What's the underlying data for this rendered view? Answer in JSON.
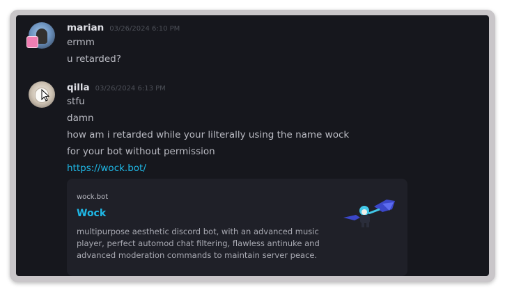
{
  "messages": [
    {
      "username": "marian",
      "timestamp": "03/26/2024 6:10 PM",
      "lines": [
        "ermm",
        "u retarded?"
      ]
    },
    {
      "username": "qilla",
      "timestamp": "03/26/2024 6:13 PM",
      "lines": [
        "stfu",
        "damn",
        "how am i retarded while your lilterally using the name wock",
        "for your bot without permission"
      ],
      "link": "https://wock.bot/",
      "embed": {
        "provider": "wock.bot",
        "title": "Wock",
        "description": "multipurpose aesthetic discord bot, with an advanced music player, perfect automod chat filtering, flawless antinuke and advanced moderation commands to maintain server peace."
      }
    }
  ],
  "colors": {
    "background": "#16171d",
    "link": "#1fb8e6",
    "embed_background": "#1f2028",
    "frame": "#c9c6c9"
  },
  "icons": [
    "mouse-cursor-icon",
    "user-avatar",
    "wock-bot-thumbnail"
  ]
}
